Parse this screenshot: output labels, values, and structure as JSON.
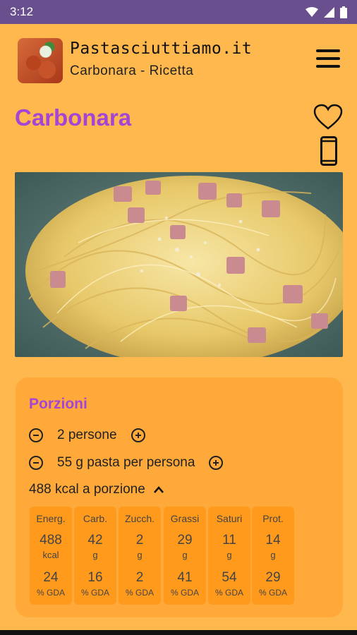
{
  "status": {
    "time": "3:12"
  },
  "app": {
    "name": "Pastasciuttiamo.it",
    "subtitle": "Carbonara - Ricetta"
  },
  "recipe": {
    "title": "Carbonara"
  },
  "portions": {
    "title": "Porzioni",
    "people": "2 persone",
    "pasta": "55 g pasta per persona",
    "kcal": "488 kcal a porzione"
  },
  "nutrition": [
    {
      "label": "Energ.",
      "value": "488",
      "unit": "kcal",
      "pct": "24",
      "gda": "% GDA"
    },
    {
      "label": "Carb.",
      "value": "42",
      "unit": "g",
      "pct": "16",
      "gda": "% GDA"
    },
    {
      "label": "Zucch.",
      "value": "2",
      "unit": "g",
      "pct": "2",
      "gda": "% GDA"
    },
    {
      "label": "Grassi",
      "value": "29",
      "unit": "g",
      "pct": "41",
      "gda": "% GDA"
    },
    {
      "label": "Saturi",
      "value": "11",
      "unit": "g",
      "pct": "54",
      "gda": "% GDA"
    },
    {
      "label": "Prot.",
      "value": "14",
      "unit": "g",
      "pct": "29",
      "gda": "% GDA"
    }
  ],
  "colors": {
    "background": "#ffb84d",
    "accent": "#a545d6",
    "status_bar": "#6a4f8e",
    "card": "#ffa93a",
    "tile": "#ff9a1c"
  },
  "icons": [
    "wifi-icon",
    "signal-icon",
    "battery-icon",
    "menu-icon",
    "heart-icon",
    "phone-icon",
    "minus-icon",
    "plus-icon",
    "chevron-up-icon"
  ]
}
